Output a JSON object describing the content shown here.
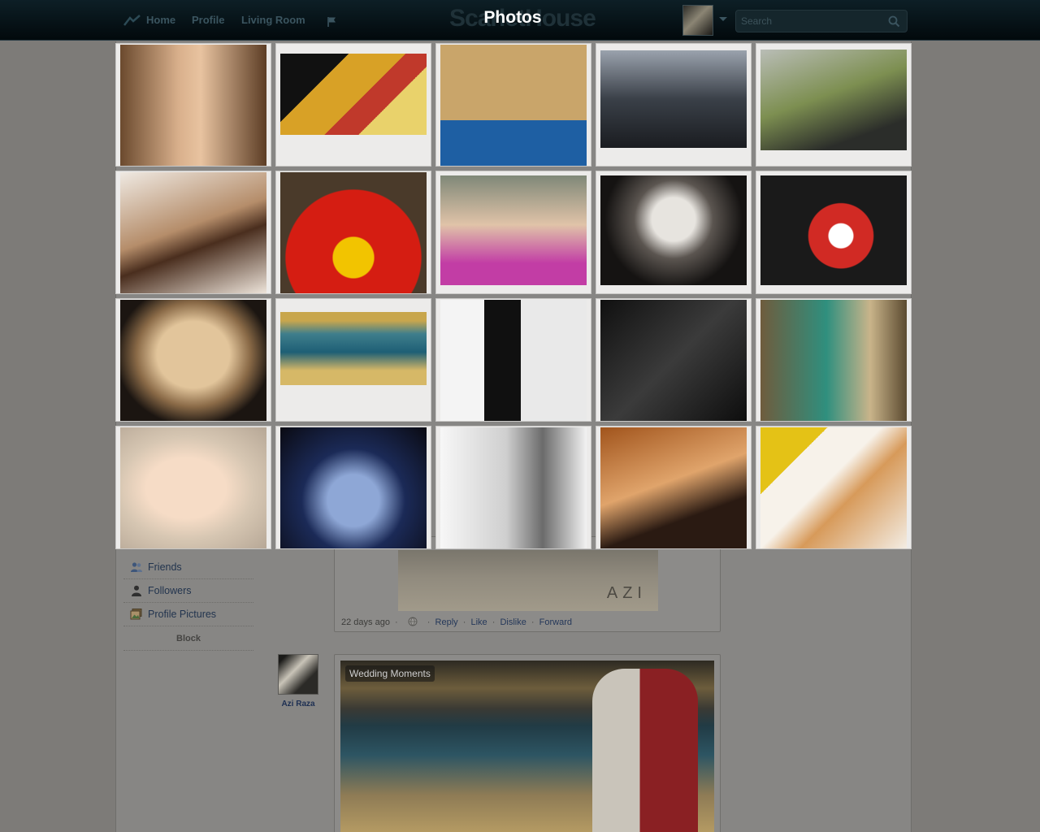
{
  "nav": {
    "links": [
      "Home",
      "Profile",
      "Living Room"
    ],
    "brand": "ScarletHouse",
    "heading": "Photos",
    "search_placeholder": "Search"
  },
  "sidebar": {
    "items": [
      {
        "label": "Friends",
        "icon": "friends-icon"
      },
      {
        "label": "Followers",
        "icon": "followers-icon"
      },
      {
        "label": "Profile Pictures",
        "icon": "profile-pictures-icon"
      }
    ],
    "block_label": "Block"
  },
  "post1": {
    "time": "22 days ago",
    "actions": [
      "Reply",
      "Like",
      "Dislike",
      "Forward"
    ],
    "watermark": "AZI"
  },
  "post2": {
    "author": "Azi Raza",
    "album_tag": "Wedding Moments"
  },
  "colors": {
    "nav_bg": "#02090c",
    "heading": "#ffffff",
    "link": "#25385a"
  },
  "photos": [
    {
      "name": "portrait-brunette",
      "bg": "linear-gradient(90deg,#6b4a2e,#d9b08c 40%,#e8c3a0 55%,#5c3d25)"
    },
    {
      "name": "stationery-calculator",
      "bg": "linear-gradient(135deg,#111 0 30%,#d8a126 30% 55%,#c0392b 55% 70%,#e9d26b 70%)"
    },
    {
      "name": "cookie-faces",
      "bg": "linear-gradient(180deg,#c9a56a 0 62%,#1e5fa3 62% 100%)"
    },
    {
      "name": "hands-lighter",
      "bg": "linear-gradient(180deg,#9aa2ad,#3a4048 50%,#1a1c20)"
    },
    {
      "name": "camera-green",
      "bg": "linear-gradient(160deg,#b9bdb6,#7d8f51 45%,#2b2d2a 80%)"
    },
    {
      "name": "tiramisu-dessert",
      "bg": "linear-gradient(160deg,#efe9e2,#b58d6a 45%,#4a2e1e 60%,#efe6dc)"
    },
    {
      "name": "ferrari-logo",
      "bg": "radial-gradient(circle at 50% 70%,#f2c400 0 18%,#d51d12 19% 60%,#4a3a2a 61%)"
    },
    {
      "name": "girl-funny-face",
      "bg": "linear-gradient(180deg,#7f8878,#e0c3a8 45%,#c23da5 80%)"
    },
    {
      "name": "canopy-night",
      "bg": "radial-gradient(circle at 50% 40%,#e7e4df 0 22%,#5b5550 40%,#151312 70%)"
    },
    {
      "name": "ferrari-world-sign",
      "bg": "radial-gradient(circle at 55% 55%,#ffffff 0 12%,#d12a24 13% 32%,#1a1a1a 33%)"
    },
    {
      "name": "woman-face-sepia",
      "bg": "radial-gradient(ellipse at 50% 45%,#e2c59b 0 35%,#8a6a47 55%,#1b1511 75%)"
    },
    {
      "name": "wedding-beach",
      "bg": "linear-gradient(180deg,#c8a64d 0 12%,#3f7e8c 30%,#1e5f75 55%,#d6b867 80%)"
    },
    {
      "name": "fashion-bw",
      "bg": "linear-gradient(90deg,#f4f4f4 0 30%,#101010 30% 55%,#e9e9e9 55%)"
    },
    {
      "name": "dark-branches",
      "bg": "linear-gradient(135deg,#101010,#3b3b3b 50%,#0d0d0d)"
    },
    {
      "name": "green-gown",
      "bg": "linear-gradient(90deg,#6f5c3d,#2f8f7e 45%,#c9b48a 75%,#5b4a30)"
    },
    {
      "name": "veil-portrait",
      "bg": "radial-gradient(ellipse at 45% 50%,#f6dcc6 0 35%,#d6c6b2 60%,#b6a796)"
    },
    {
      "name": "blue-headdress",
      "bg": "radial-gradient(ellipse at 50% 60%,#8ea7d6 0 25%,#1b2a57 50%,#0a0a12)"
    },
    {
      "name": "woman-profile-white",
      "bg": "linear-gradient(90deg,#f7f7f7,#cfcfcf 45%,#6b6b6b 70%,#f2f2f2)"
    },
    {
      "name": "heels-gold",
      "bg": "linear-gradient(160deg,#a1541c,#e0a46b 45%,#2a1a12 70%)"
    },
    {
      "name": "yellow-makeup",
      "bg": "linear-gradient(135deg,#e4c216 0 25%,#f7f2ea 25% 45%,#d79a5a 60%,#f3ede4)"
    }
  ]
}
